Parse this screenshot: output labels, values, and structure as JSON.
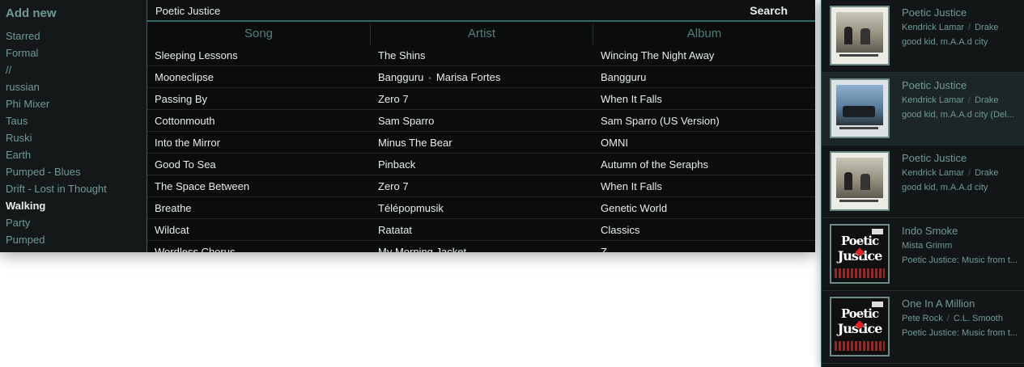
{
  "sidebar": {
    "add_new": "Add new",
    "playlists": [
      "Starred",
      "Formal",
      "//",
      "russian",
      "Phi Mixer",
      "Taus",
      "Ruski",
      "Earth",
      "Pumped - Blues",
      "Drift - Lost in Thought",
      "Walking",
      "Party",
      "Pumped"
    ],
    "active": "Walking"
  },
  "search": {
    "query": "Poetic Justice",
    "button": "Search"
  },
  "table": {
    "headers": [
      "Song",
      "Artist",
      "Album"
    ],
    "rows": [
      {
        "song": "Sleeping Lessons",
        "artist": [
          "The Shins"
        ],
        "album": "Wincing The Night Away"
      },
      {
        "song": "Mooneclipse",
        "artist": [
          "Bangguru",
          "Marisa Fortes"
        ],
        "album": "Bangguru"
      },
      {
        "song": "Passing By",
        "artist": [
          "Zero 7"
        ],
        "album": "When It Falls"
      },
      {
        "song": "Cottonmouth",
        "artist": [
          "Sam Sparro"
        ],
        "album": "Sam Sparro (US Version)"
      },
      {
        "song": "Into the Mirror",
        "artist": [
          "Minus The Bear"
        ],
        "album": "OMNI"
      },
      {
        "song": "Good To Sea",
        "artist": [
          "Pinback"
        ],
        "album": "Autumn of the Seraphs"
      },
      {
        "song": "The Space Between",
        "artist": [
          "Zero 7"
        ],
        "album": "When It Falls"
      },
      {
        "song": "Breathe",
        "artist": [
          "Télépopmusik"
        ],
        "album": "Genetic World"
      },
      {
        "song": "Wildcat",
        "artist": [
          "Ratatat"
        ],
        "album": "Classics"
      },
      {
        "song": "Wordless Chorus",
        "artist": [
          "My Morning Jacket"
        ],
        "album": "Z"
      }
    ]
  },
  "results": [
    {
      "title": "Poetic Justice",
      "artists": [
        "Kendrick Lamar",
        "Drake"
      ],
      "album": "good kid, m.A.A.d city",
      "art": "gkmc",
      "selected": false
    },
    {
      "title": "Poetic Justice",
      "artists": [
        "Kendrick Lamar",
        "Drake"
      ],
      "album": "good kid, m.A.A.d city (Del...",
      "art": "gkmc-dlx",
      "selected": true
    },
    {
      "title": "Poetic Justice",
      "artists": [
        "Kendrick Lamar",
        "Drake"
      ],
      "album": "good kid, m.A.A.d city",
      "art": "gkmc",
      "selected": false
    },
    {
      "title": "Indo Smoke",
      "artists": [
        "Mista Grimm"
      ],
      "album": "Poetic Justice: Music from t...",
      "art": "pj",
      "selected": false
    },
    {
      "title": "One In A Million",
      "artists": [
        "Pete Rock",
        "C.L. Smooth"
      ],
      "album": "Poetic Justice: Music from t...",
      "art": "pj",
      "selected": false
    }
  ],
  "art_text": {
    "pj_line1": "Poetic",
    "pj_line2": "Justice"
  },
  "colors": {
    "accent": "#2f6a67",
    "muted_text": "#6f9a97",
    "text": "#e8ecec",
    "background": "#0b0c0c"
  }
}
